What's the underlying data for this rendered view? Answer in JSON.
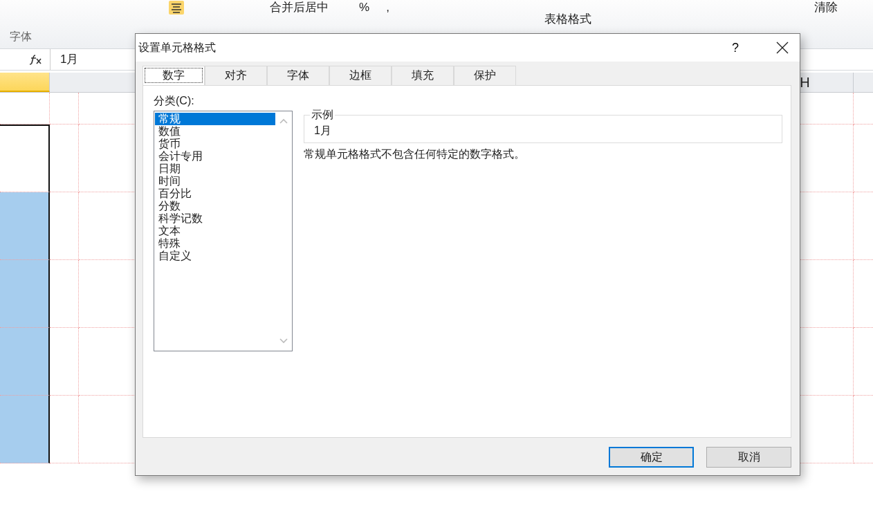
{
  "ribbon": {
    "buttons": [
      {
        "kind": "icon"
      },
      {
        "kind": "label",
        "label": "合并后居中"
      },
      {
        "kind": "label",
        "label": "%"
      },
      {
        "kind": "label",
        "label": ","
      },
      {
        "kind": "label",
        "label": "表格格式"
      },
      {
        "kind": "label",
        "label": "清除"
      }
    ],
    "group_label": "字体"
  },
  "formula_bar": {
    "value": "1月"
  },
  "sheet": {
    "columns": [
      {
        "selected": true
      },
      {
        "label": "H",
        "selected": false
      }
    ],
    "rows": [
      {
        "selected": false,
        "active": false
      },
      {
        "selected": true,
        "active": true
      },
      {
        "selected": true,
        "active": false
      },
      {
        "selected": true,
        "active": false
      },
      {
        "selected": true,
        "active": false
      },
      {
        "selected": true,
        "active": false
      }
    ]
  },
  "dialog": {
    "title": "设置单元格格式",
    "help": "?",
    "tabs": [
      {
        "label": "数字",
        "selected": true
      },
      {
        "label": "对齐",
        "selected": false
      },
      {
        "label": "字体",
        "selected": false
      },
      {
        "label": "边框",
        "selected": false
      },
      {
        "label": "填充",
        "selected": false
      },
      {
        "label": "保护",
        "selected": false
      }
    ],
    "category_label": "分类(C):",
    "categories": [
      {
        "label": "常规",
        "selected": true
      },
      {
        "label": "数值",
        "selected": false
      },
      {
        "label": "货币",
        "selected": false
      },
      {
        "label": "会计专用",
        "selected": false
      },
      {
        "label": "日期",
        "selected": false
      },
      {
        "label": "时间",
        "selected": false
      },
      {
        "label": "百分比",
        "selected": false
      },
      {
        "label": "分数",
        "selected": false
      },
      {
        "label": "科学记数",
        "selected": false
      },
      {
        "label": "文本",
        "selected": false
      },
      {
        "label": "特殊",
        "selected": false
      },
      {
        "label": "自定义",
        "selected": false
      }
    ],
    "sample": {
      "label": "示例",
      "value": "1月"
    },
    "description": "常规单元格格式不包含任何特定的数字格式。",
    "buttons": [
      {
        "label": "确定",
        "default": true
      },
      {
        "label": "取消",
        "default": false
      }
    ]
  }
}
